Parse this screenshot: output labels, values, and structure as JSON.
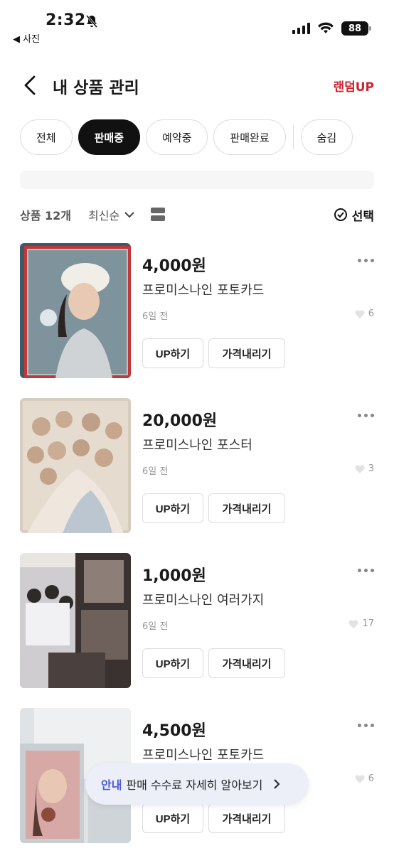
{
  "status_bar": {
    "time": "2:32",
    "back_app": "◀ 사진",
    "battery": "88"
  },
  "header": {
    "title": "내 상품 관리",
    "action": "랜덤UP"
  },
  "tabs": [
    {
      "label": "전체",
      "active": false
    },
    {
      "label": "판매중",
      "active": true
    },
    {
      "label": "예약중",
      "active": false
    },
    {
      "label": "판매완료",
      "active": false
    },
    {
      "label": "숨김",
      "active": false
    }
  ],
  "toolbar": {
    "count": "상품 12개",
    "sort": "최신순",
    "select": "선택"
  },
  "items": [
    {
      "price": "4,000원",
      "name": "프로미스나인 포토카드",
      "date": "6일 전",
      "likes": "6",
      "up_label": "UP하기",
      "price_down_label": "가격내리기"
    },
    {
      "price": "20,000원",
      "name": "프로미스나인 포스터",
      "date": "6일 전",
      "likes": "3",
      "up_label": "UP하기",
      "price_down_label": "가격내리기"
    },
    {
      "price": "1,000원",
      "name": "프로미스나인 여러가지",
      "date": "6일 전",
      "likes": "17",
      "up_label": "UP하기",
      "price_down_label": "가격내리기"
    },
    {
      "price": "4,500원",
      "name": "프로미스나인 포토카드",
      "date": "",
      "likes": "6",
      "up_label": "UP하기",
      "price_down_label": "가격내리기"
    }
  ],
  "toast": {
    "tag": "안내",
    "text": "판매 수수료 자세히 알아보기"
  },
  "colors": {
    "accent_red": "#d0232f",
    "toast_blue": "#4a5bd4"
  }
}
